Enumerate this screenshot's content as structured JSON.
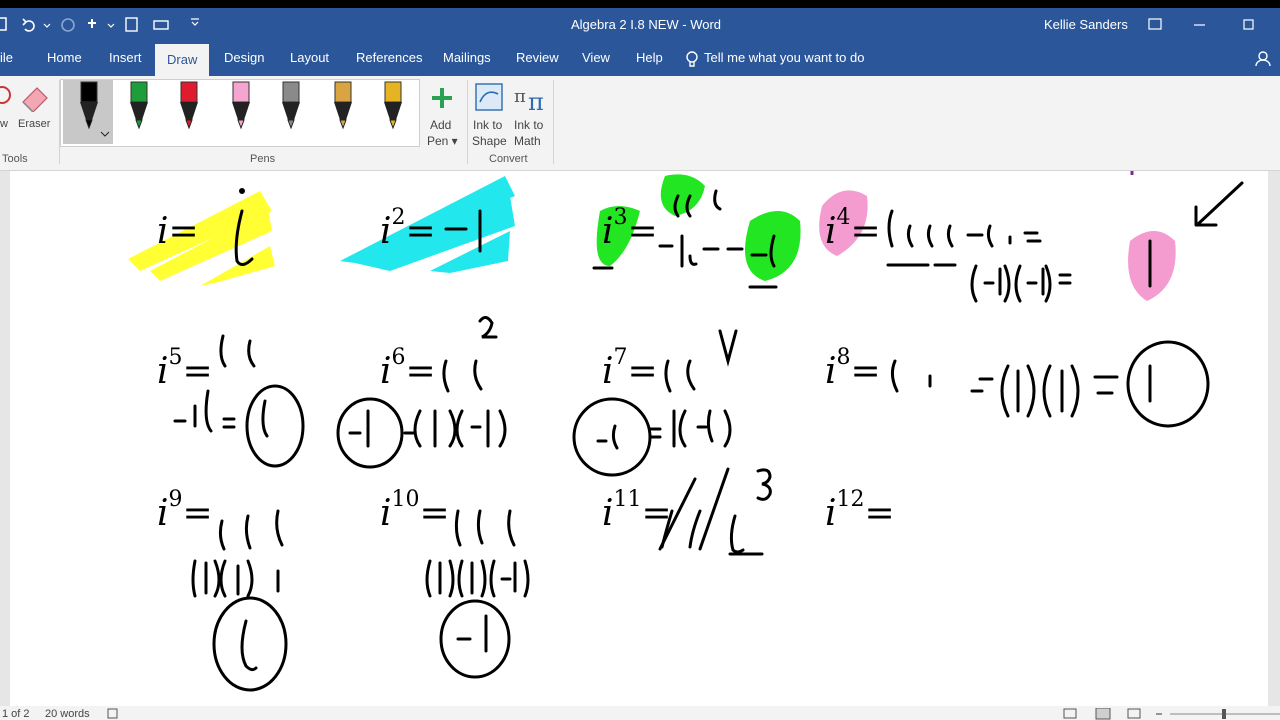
{
  "window": {
    "title": "Algebra 2 I.8 NEW  -  Word",
    "user": "Kellie Sanders"
  },
  "ribbon_tabs": [
    "ile",
    "Home",
    "Insert",
    "Draw",
    "Design",
    "Layout",
    "References",
    "Mailings",
    "Review",
    "View",
    "Help"
  ],
  "tell_me": "Tell me what you want to do",
  "ribbon": {
    "tools_partial": "w",
    "eraser": "Eraser",
    "tools_group": "Tools",
    "pens_group": "Pens",
    "add_pen": [
      "Add",
      "Pen ▾"
    ],
    "ink_to_shape": [
      "Ink to",
      "Shape"
    ],
    "ink_to_math": [
      "Ink to",
      "Math"
    ],
    "convert_group": "Convert",
    "pen_colors": [
      "#000000",
      "#1e9e3a",
      "#e01b2e",
      "#f4a6d0",
      "#8a8a8a",
      "#d9a441",
      "#e6b422"
    ]
  },
  "status": {
    "page": "1 of 2",
    "words": "20 words"
  },
  "equations": [
    {
      "base": "i",
      "exp": "",
      "rhs": "="
    },
    {
      "base": "i",
      "exp": "2",
      "rhs": "="
    },
    {
      "base": "i",
      "exp": "3",
      "rhs": "="
    },
    {
      "base": "i",
      "exp": "4",
      "rhs": "="
    },
    {
      "base": "i",
      "exp": "5",
      "rhs": "="
    },
    {
      "base": "i",
      "exp": "6",
      "rhs": "="
    },
    {
      "base": "i",
      "exp": "7",
      "rhs": "="
    },
    {
      "base": "i",
      "exp": "8",
      "rhs": "="
    },
    {
      "base": "i",
      "exp": "9",
      "rhs": "="
    },
    {
      "base": "i",
      "exp": "10",
      "rhs": "="
    },
    {
      "base": "i",
      "exp": "11",
      "rhs": "="
    },
    {
      "base": "i",
      "exp": "12",
      "rhs": "="
    }
  ],
  "highlights": {
    "yellow": "#ffff33",
    "cyan": "#22e8ee",
    "green": "#22e622",
    "pink": "#f49bcf"
  }
}
